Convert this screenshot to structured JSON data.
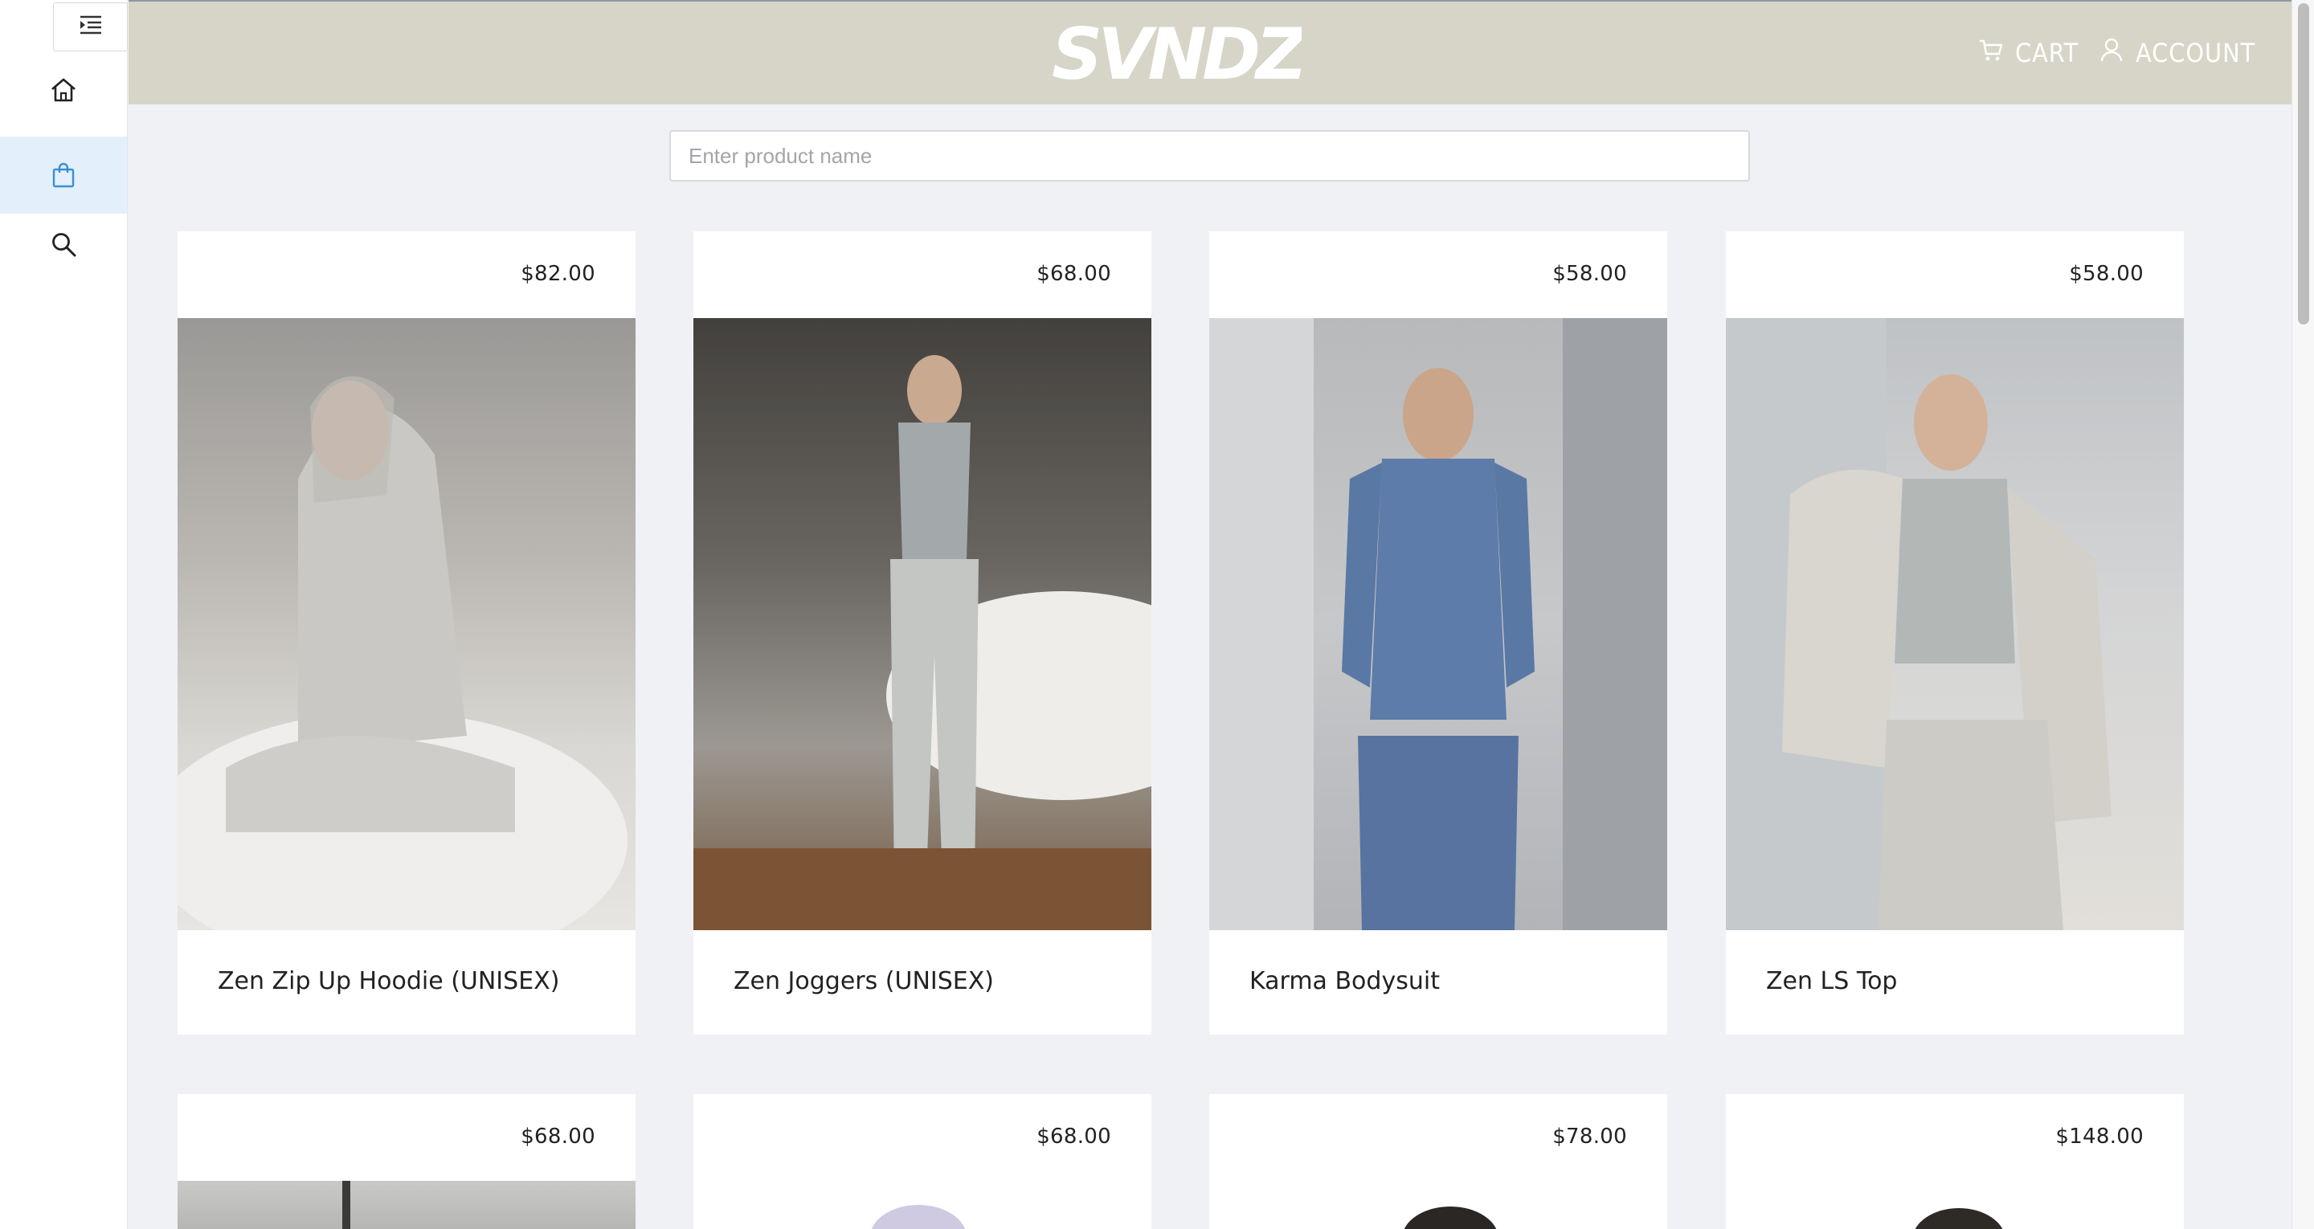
{
  "brand": {
    "logo_text": "SVNDZ"
  },
  "header": {
    "cart_label": "CART",
    "account_label": "ACCOUNT"
  },
  "sidebar": {
    "items": [
      {
        "name": "home",
        "icon": "home-icon",
        "active": false
      },
      {
        "name": "shop",
        "icon": "shopping-bag-icon",
        "active": true
      },
      {
        "name": "search",
        "icon": "search-icon",
        "active": false
      }
    ]
  },
  "search": {
    "placeholder": "Enter product name",
    "value": ""
  },
  "products": [
    {
      "name": "Zen Zip Up Hoodie (UNISEX)",
      "price": "$82.00"
    },
    {
      "name": "Zen Joggers (UNISEX)",
      "price": "$68.00"
    },
    {
      "name": "Karma Bodysuit",
      "price": "$58.00"
    },
    {
      "name": "Zen LS Top",
      "price": "$58.00"
    },
    {
      "name": "",
      "price": "$68.00"
    },
    {
      "name": "",
      "price": "$68.00"
    },
    {
      "name": "",
      "price": "$78.00"
    },
    {
      "name": "",
      "price": "$148.00"
    }
  ],
  "colors": {
    "header_bg": "#d7d5c7",
    "page_bg": "#eff1f5",
    "active_nav_bg": "#e3f0fb",
    "active_nav_icon": "#3a8fd6"
  }
}
